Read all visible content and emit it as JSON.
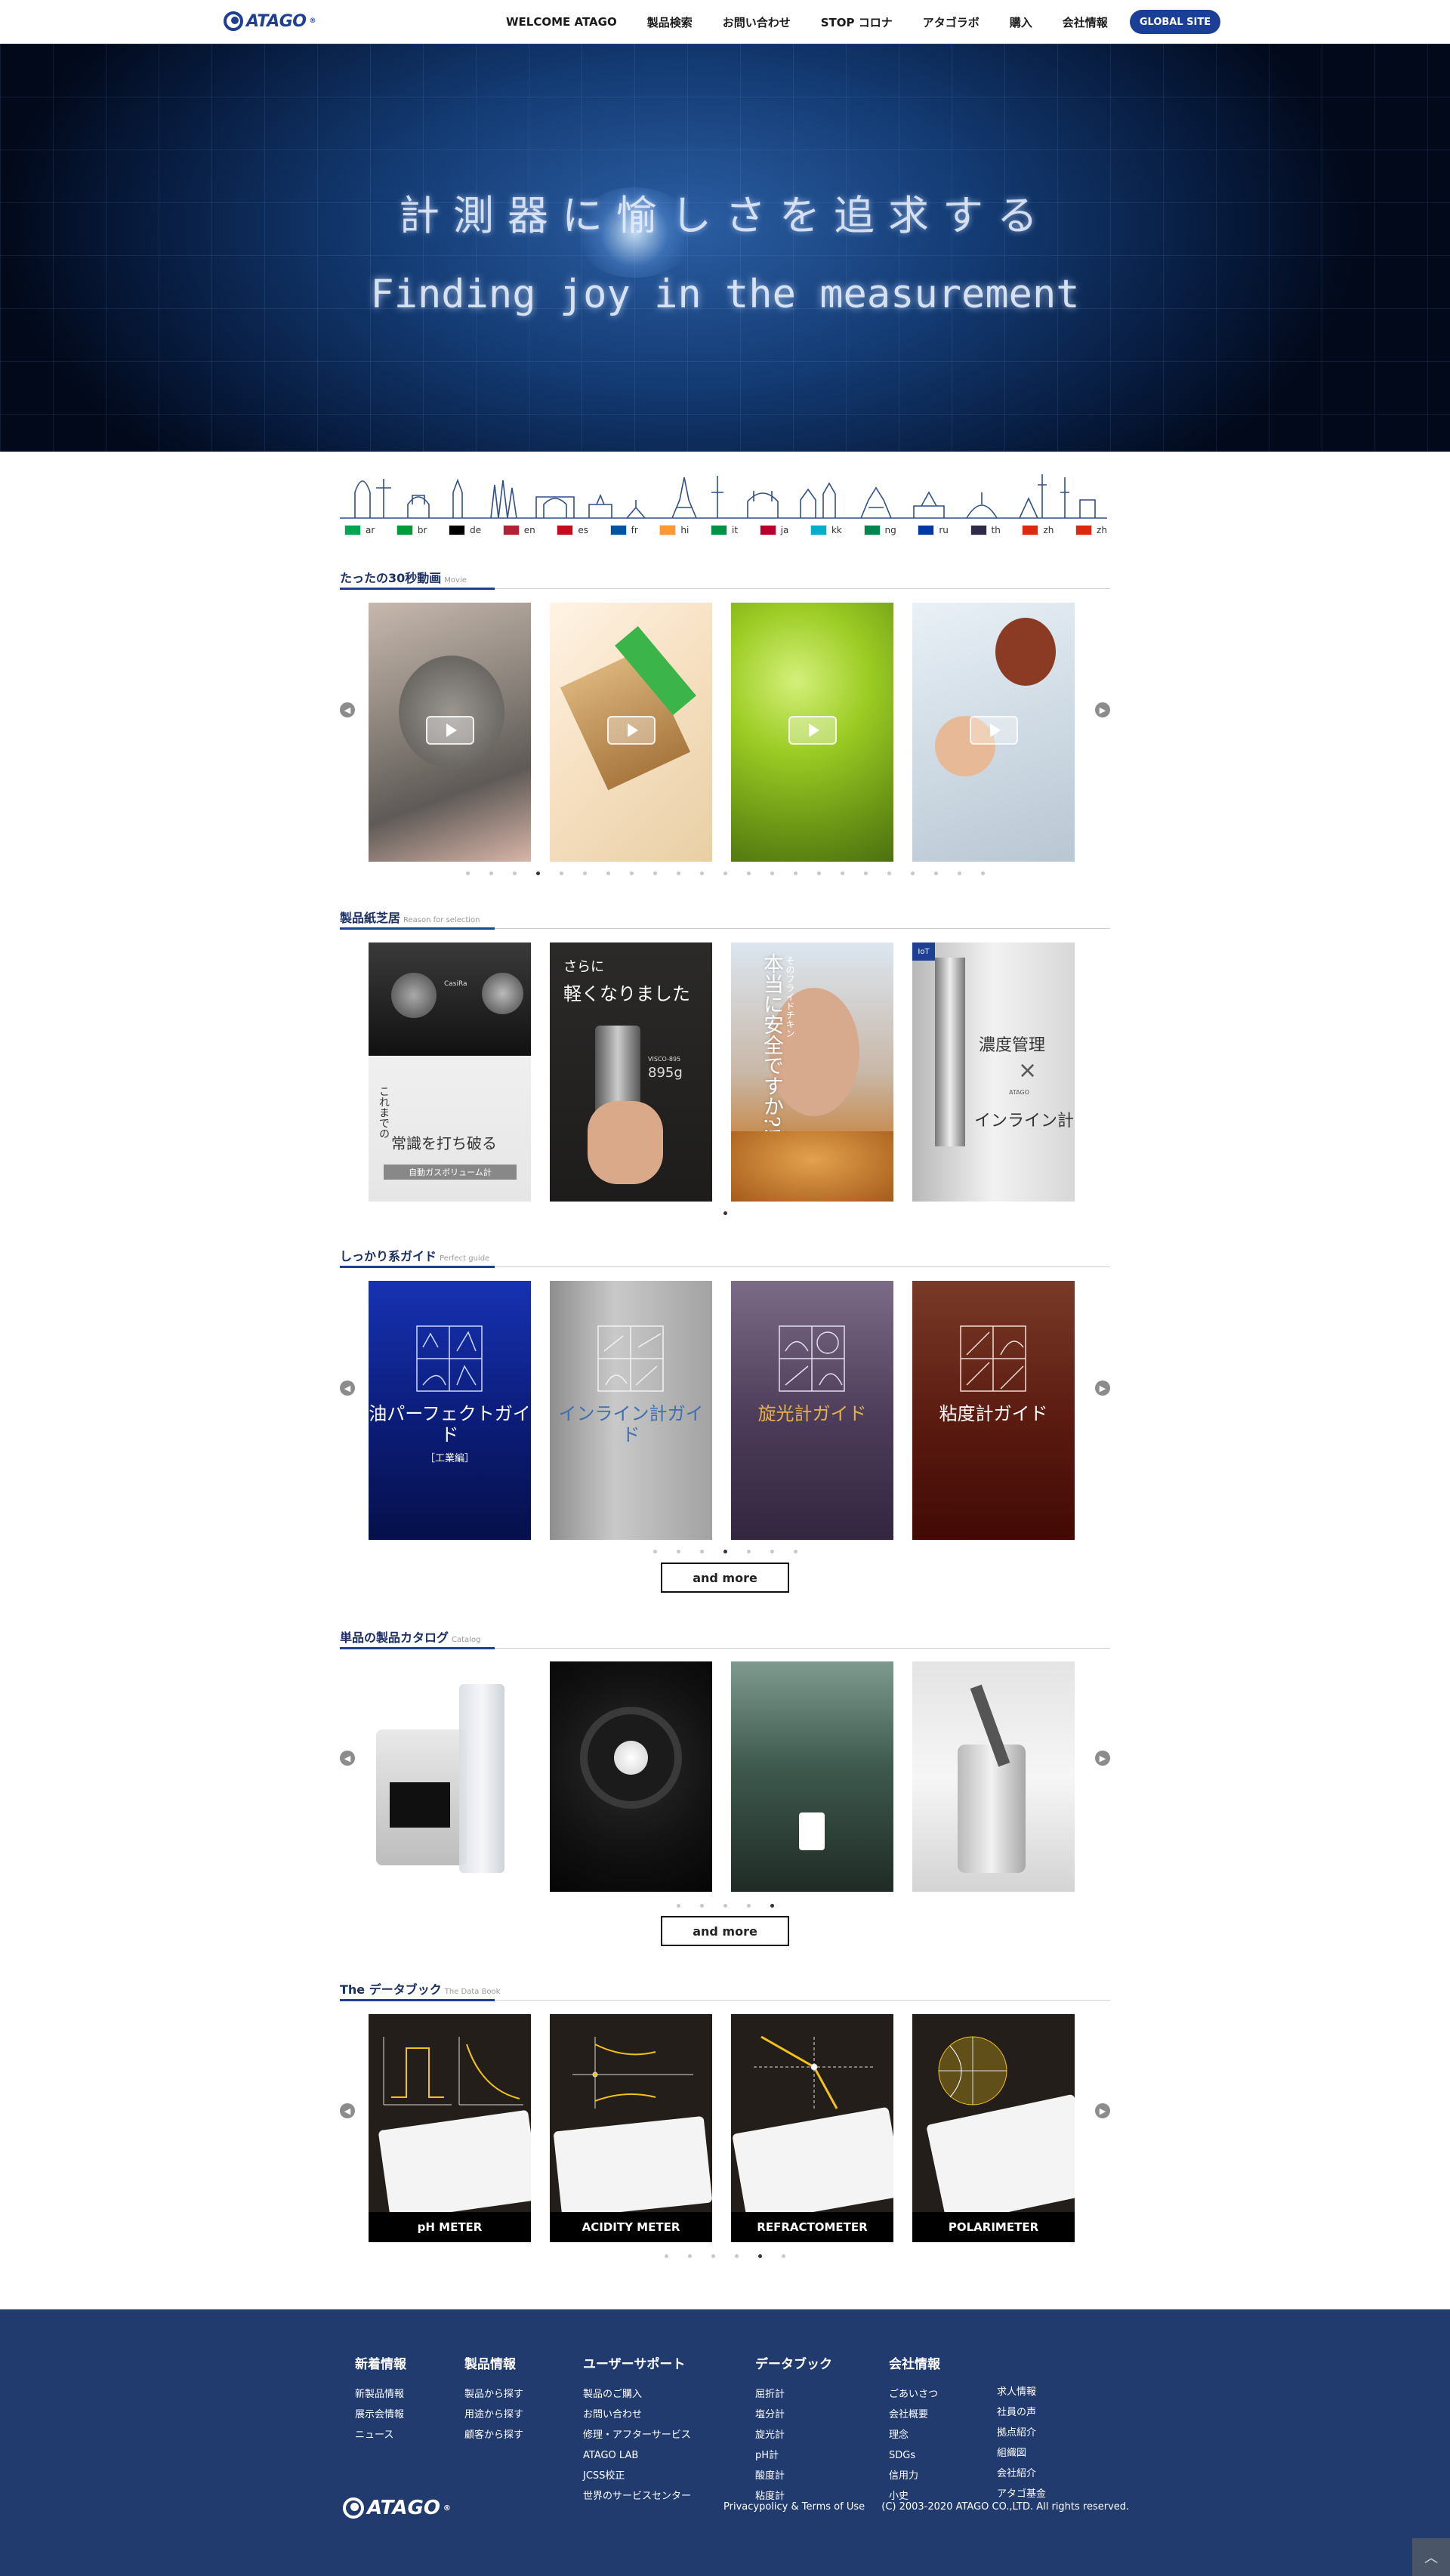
{
  "header": {
    "logo_text": "ATAGO",
    "nav": [
      "WELCOME ATAGO",
      "製品検索",
      "お問い合わせ",
      "STOP コロナ",
      "アタゴラボ",
      "購入",
      "会社情報"
    ],
    "global_button": "GLOBAL SITE"
  },
  "hero": {
    "title_jp": "計測器に愉しさを追求する",
    "title_en": "Finding joy in the measurement"
  },
  "languages": [
    {
      "code": "ar",
      "flag": "#00a651"
    },
    {
      "code": "br",
      "flag": "#009c3b"
    },
    {
      "code": "de",
      "flag": "#000000"
    },
    {
      "code": "en",
      "flag": "#b22234"
    },
    {
      "code": "es",
      "flag": "#c60b1e"
    },
    {
      "code": "fr",
      "flag": "#0055a4"
    },
    {
      "code": "hi",
      "flag": "#ff9933"
    },
    {
      "code": "it",
      "flag": "#009246"
    },
    {
      "code": "ja",
      "flag": "#bc002d"
    },
    {
      "code": "kk",
      "flag": "#00afca"
    },
    {
      "code": "ng",
      "flag": "#008751"
    },
    {
      "code": "ru",
      "flag": "#0039a6"
    },
    {
      "code": "th",
      "flag": "#2d2a4a"
    },
    {
      "code": "zh",
      "flag": "#de2910"
    },
    {
      "code": "zh",
      "flag": "#de2910"
    }
  ],
  "sections": {
    "videos": {
      "title": "たったの30秒動画",
      "sub": "Movie"
    },
    "shibai": {
      "title": "製品紙芝居",
      "sub": "Reason for selection"
    },
    "guide": {
      "title": "しっかり系ガイド",
      "sub": "Perfect guide"
    },
    "catalog": {
      "title": "単品の製品カタログ",
      "sub": "Catalog"
    },
    "databook": {
      "title": "The データブック",
      "sub": "The Data Book"
    }
  },
  "shibai_cards": [
    {
      "lines": [
        "これまでの",
        "常識を打ち破る"
      ],
      "badge": "自動ガスボリューム計",
      "device": "CasiRa"
    },
    {
      "lines": [
        "さらに",
        "軽くなりました"
      ],
      "device": "VISCO-895",
      "weight": "895g"
    },
    {
      "lines": [
        "そのフライドチキン",
        "本当に安全ですか?!"
      ]
    },
    {
      "tag": "IoT",
      "lines": [
        "濃度管理",
        "インライン計"
      ],
      "brand": "ATAGO"
    }
  ],
  "guide_cards": [
    "油パーフェクトガイド",
    "インライン計ガイド",
    "旋光計ガイド",
    "粘度計ガイド"
  ],
  "guide_sub": "［工業編］",
  "book_cards": [
    "pH METER",
    "ACIDITY METER",
    "REFRACTOMETER",
    "POLARIMETER"
  ],
  "and_more": "and more",
  "footer": {
    "columns": [
      {
        "head": "新着情報",
        "links": [
          "新製品情報",
          "展示会情報",
          "ニュース"
        ]
      },
      {
        "head": "製品情報",
        "links": [
          "製品から探す",
          "用途から探す",
          "顧客から探す"
        ]
      },
      {
        "head": "ユーザーサポート",
        "links": [
          "製品のご購入",
          "お問い合わせ",
          "修理・アフターサービス",
          "ATAGO LAB",
          "JCSS校正",
          "世界のサービスセンター"
        ]
      },
      {
        "head": "データブック",
        "links": [
          "屈折計",
          "塩分計",
          "旋光計",
          "pH計",
          "酸度計",
          "粘度計"
        ]
      },
      {
        "head": "会社情報",
        "links": [
          "ごあいさつ",
          "会社概要",
          "理念",
          "SDGs",
          "信用力",
          "小史"
        ]
      },
      {
        "head": "",
        "links": [
          "求人情報",
          "社員の声",
          "拠点紹介",
          "組織図",
          "会社紹介",
          "アタゴ基金"
        ]
      }
    ],
    "logo_text": "ATAGO",
    "policy": "Privacypolicy & Terms of Use",
    "copyright": "(C) 2003-2020 ATAGO CO.,LTD. All rights reserved."
  }
}
